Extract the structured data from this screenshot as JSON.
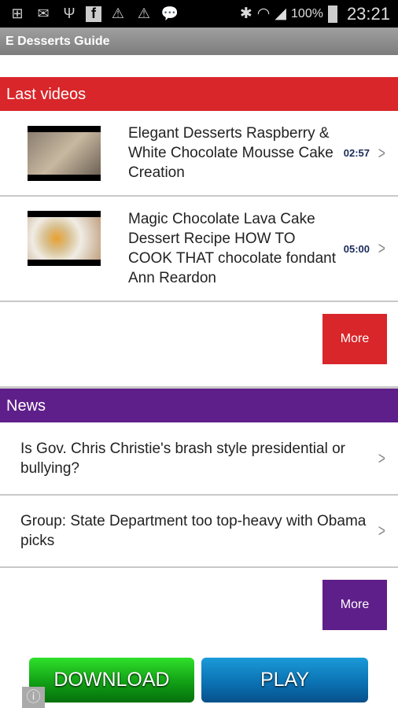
{
  "status_bar": {
    "battery": "100%",
    "time": "23:21"
  },
  "app": {
    "title": "E Desserts Guide"
  },
  "videos": {
    "header": "Last videos",
    "more_label": "More",
    "color": "#d8262a",
    "items": [
      {
        "title": "Elegant Desserts Raspberry & White Chocolate Mousse Cake Creation",
        "duration": "02:57"
      },
      {
        "title": "Magic Chocolate Lava Cake Dessert Recipe HOW TO COOK THAT chocolate fondant Ann Reardon",
        "duration": "05:00"
      }
    ]
  },
  "news": {
    "header": "News",
    "more_label": "More",
    "color": "#5f1f8a",
    "items": [
      {
        "title": "Is Gov. Chris Christie's brash style presidential or bullying?"
      },
      {
        "title": "Group: State Department too top-heavy with Obama picks"
      }
    ]
  },
  "ad": {
    "download_label": "DOWNLOAD",
    "play_label": "PLAY"
  }
}
